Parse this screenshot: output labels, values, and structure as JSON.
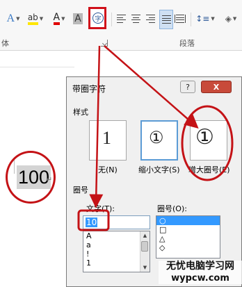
{
  "ribbon": {
    "group_label_left": "体",
    "group_label_paragraph": "段落",
    "enclose_icon_char": "字",
    "font_icons": [
      "A",
      "ab",
      "A",
      "A"
    ],
    "icons": [
      "text-effects-icon",
      "highlight-icon",
      "font-color-icon",
      "char-shading-icon",
      "enclose-char-icon",
      "align-left-icon",
      "align-center-icon",
      "align-right-icon",
      "justify-icon",
      "distributed-icon",
      "line-spacing-icon",
      "shading-icon"
    ]
  },
  "document": {
    "selected_text": "100",
    "paragraph_mark": "↵"
  },
  "dialog": {
    "title": "带圈字符",
    "help_label": "?",
    "close_label": "X",
    "style_section": "样式",
    "styles": [
      {
        "label": "无(N)",
        "preview": "1"
      },
      {
        "label": "缩小文字(S)",
        "preview": "①"
      },
      {
        "label": "增大圈号(E)",
        "preview": "①"
      }
    ],
    "circle_section": "圈号",
    "text_label": "文字(T):",
    "text_value": "10",
    "text_list": [
      "A",
      "a",
      "!",
      "1"
    ],
    "circle_label": "圈号(O):",
    "circle_list": [
      "○",
      "□",
      "△",
      "◇"
    ]
  },
  "watermark": {
    "line1": "无忧电脑学习网",
    "line2": "wypcw.com"
  },
  "colors": {
    "annotation_red": "#c41216",
    "selection_blue": "#3399ff",
    "brand_blue": "#2b5797"
  }
}
